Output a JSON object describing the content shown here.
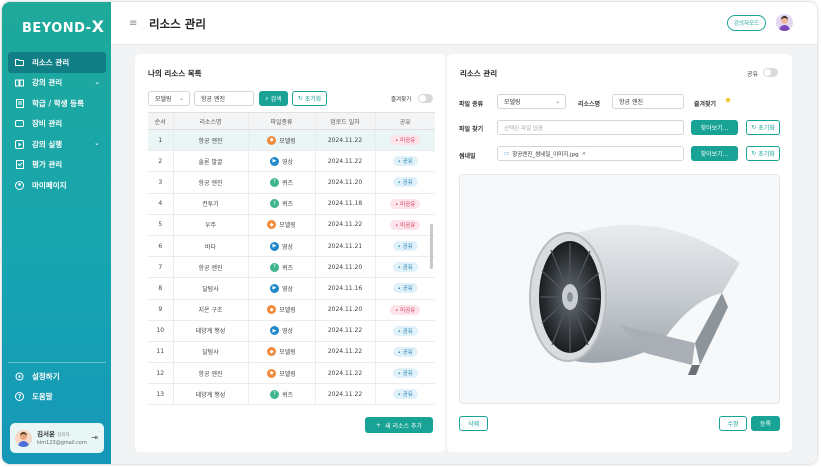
{
  "sidebar": {
    "logo": "BEYOND-",
    "logo_mark": "X",
    "items": [
      {
        "label": "리소스 관리",
        "icon": "folder-icon",
        "active": true,
        "has_chevron": false
      },
      {
        "label": "강의 관리",
        "icon": "book-icon",
        "active": false,
        "has_chevron": true
      },
      {
        "label": "학급 / 학생 등록",
        "icon": "register-icon",
        "active": false,
        "has_chevron": false
      },
      {
        "label": "장비 관리",
        "icon": "device-icon",
        "active": false,
        "has_chevron": false
      },
      {
        "label": "강의 실행",
        "icon": "play-icon",
        "active": false,
        "has_chevron": true
      },
      {
        "label": "평가 관리",
        "icon": "evaluation-icon",
        "active": false,
        "has_chevron": false
      },
      {
        "label": "마이페이지",
        "icon": "user-icon",
        "active": false,
        "has_chevron": false
      }
    ],
    "bottom_items": [
      {
        "label": "설정하기",
        "icon": "gear-icon"
      },
      {
        "label": "도움말",
        "icon": "help-icon"
      }
    ],
    "user": {
      "name": "김서윤",
      "role": "강의자",
      "email": "kim123@gmail.com"
    }
  },
  "header": {
    "title": "리소스 관리",
    "mode_button": "강의자모드"
  },
  "left_panel": {
    "title": "나의 리소스 목록",
    "filter_select": "모델링",
    "search_value": "항공 엔진",
    "search_button": "검색",
    "reset_button": "초기화",
    "favorite_label": "즐겨찾기",
    "columns": [
      "순서",
      "리소스명",
      "파일종류",
      "업로드 일자",
      "공유"
    ],
    "rows": [
      {
        "no": "1",
        "name": "항공 엔진",
        "type": "모델링",
        "date": "2024.11.22",
        "share": "미공유"
      },
      {
        "no": "2",
        "name": "솔론 발굴",
        "type": "영상",
        "date": "2024.11.22",
        "share": "공유"
      },
      {
        "no": "3",
        "name": "항공 엔진",
        "type": "퀴즈",
        "date": "2024.11.20",
        "share": "공유"
      },
      {
        "no": "4",
        "name": "컨투기",
        "type": "퀴즈",
        "date": "2024.11.18",
        "share": "미공유"
      },
      {
        "no": "5",
        "name": "우주",
        "type": "모델링",
        "date": "2024.11.22",
        "share": "미공유"
      },
      {
        "no": "6",
        "name": "바다",
        "type": "영상",
        "date": "2024.11.21",
        "share": "공유"
      },
      {
        "no": "7",
        "name": "항공 엔진",
        "type": "퀴즈",
        "date": "2024.11.20",
        "share": "공유"
      },
      {
        "no": "8",
        "name": "달탐사",
        "type": "영상",
        "date": "2024.11.16",
        "share": "공유"
      },
      {
        "no": "9",
        "name": "지온 구조",
        "type": "모델링",
        "date": "2024.11.20",
        "share": "미공유"
      },
      {
        "no": "10",
        "name": "태양계 행성",
        "type": "영상",
        "date": "2024.11.22",
        "share": "공유"
      },
      {
        "no": "11",
        "name": "달탐사",
        "type": "모델링",
        "date": "2024.11.22",
        "share": "공유"
      },
      {
        "no": "12",
        "name": "항공 엔진",
        "type": "모델링",
        "date": "2024.11.22",
        "share": "공유"
      },
      {
        "no": "13",
        "name": "태양계 행성",
        "type": "퀴즈",
        "date": "2024.11.22",
        "share": "공유"
      }
    ],
    "add_button": "새 리소스 추가"
  },
  "right_panel": {
    "title": "리소스 관리",
    "share_label": "공유",
    "file_type_label": "파일 종류",
    "file_type_value": "모델링",
    "resource_name_label": "리소스명",
    "resource_name_value": "항공 엔진",
    "favorite_label": "즐겨찾기",
    "file_find_label": "파일 찾기",
    "file_find_placeholder": "선택된 파일 없음",
    "browse_button": "찾아보기...",
    "reset_button": "초기화",
    "thumbnail_label": "썸네일",
    "thumbnail_file": "항공엔진_썸네일_이미지.jpg",
    "delete_button": "삭제",
    "edit_button": "수정",
    "register_button": "등록"
  },
  "colors": {
    "accent": "#18a396",
    "share": "#1b7fb0",
    "unshared": "#d13b5c",
    "modeling": "#f08a3c",
    "video": "#1e88c8",
    "quiz": "#3fb58f"
  }
}
